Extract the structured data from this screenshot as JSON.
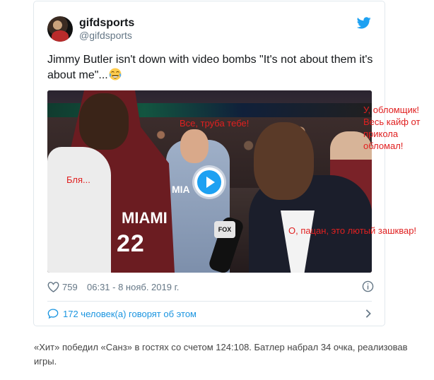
{
  "tweet": {
    "display_name": "gifdsports",
    "handle": "@gifdsports",
    "text": "Jimmy Butler isn't down with video bombs \"It's not about them it's about me\"...",
    "emoji": "tears-of-joy",
    "likes": "759",
    "timestamp": "06:31 - 8 нояб. 2019 г.",
    "conversation_label": "172 человек(а) говорят об этом"
  },
  "video": {
    "overlays": {
      "bla": "Бля...",
      "truba": "Все, труба тебе!",
      "oblomshchik": [
        "У, обломщик!",
        "Весь кайф от",
        "прикола",
        "обломал!"
      ],
      "patsan": "О, пацан, это лютый зашквар!"
    },
    "jersey_text": "MIAMI",
    "jersey_number": "22",
    "shirt_text": "MIA",
    "mic_flag": "FOX"
  },
  "article": {
    "caption_line1": "«Хит» победил «Санз» в гостях со счетом 124:108. Батлер набрал 34 очка, реализовав",
    "caption_line2": "игры."
  },
  "colors": {
    "accent": "#1da1f2",
    "link": "#1b95e0",
    "overlay_text": "#e02020",
    "muted": "#657786"
  },
  "icons": {
    "twitter_logo": "twitter-bird-icon",
    "play": "play-icon",
    "heart": "heart-icon",
    "info": "info-icon",
    "conversation": "speech-bubble-icon",
    "chevron": "chevron-right-icon"
  }
}
